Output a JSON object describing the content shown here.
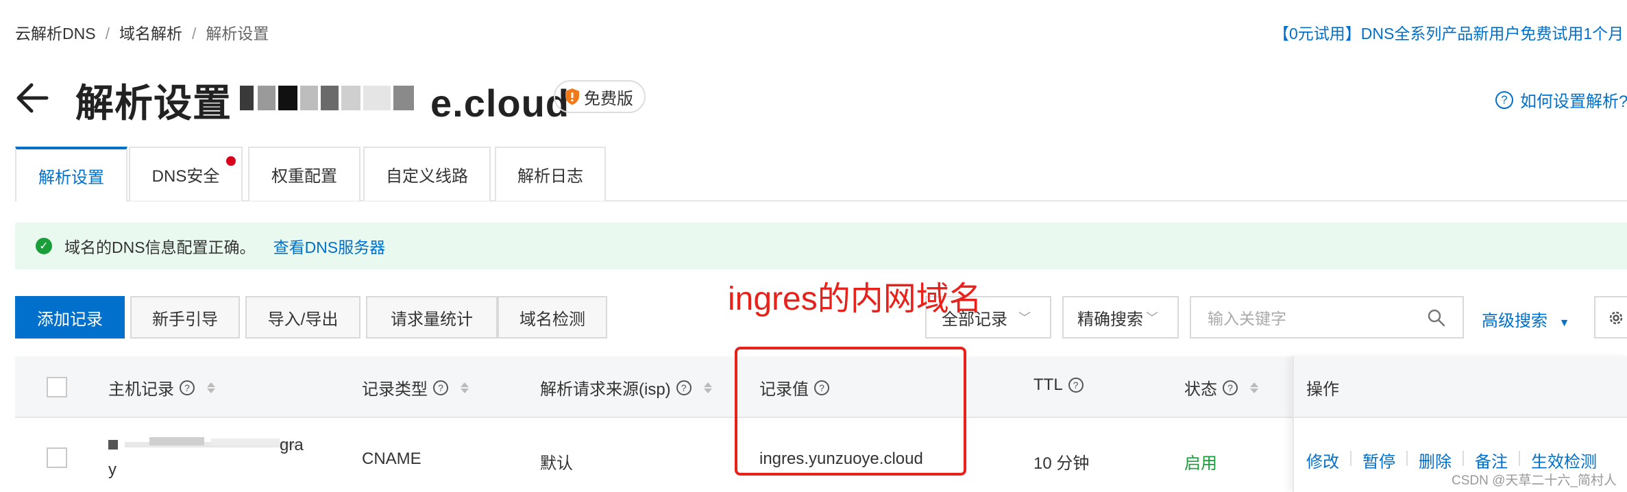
{
  "breadcrumb": {
    "item1": "云解析DNS",
    "item2": "域名解析",
    "item3": "解析设置",
    "separator": "/"
  },
  "promo": "【0元试用】DNS全系列产品新用户免费试用1个月",
  "header": {
    "title_prefix": "解析设置",
    "title_suffix": "e.cloud",
    "badge": "免费版"
  },
  "help_link": "如何设置解析?",
  "tabs": [
    "解析设置",
    "DNS安全",
    "权重配置",
    "自定义线路",
    "解析日志"
  ],
  "alert": {
    "text": "域名的DNS信息配置正确。",
    "link": "查看DNS服务器"
  },
  "toolbar": {
    "add": "添加记录",
    "guide": "新手引导",
    "import_export": "导入/导出",
    "stats": "请求量统计",
    "check": "域名检测",
    "filter_select": "全部记录",
    "match_select": "精确搜索",
    "search_placeholder": "输入关键字",
    "advanced": "高级搜索"
  },
  "annotation": "ingres的内网域名",
  "table": {
    "columns": [
      "主机记录",
      "记录类型",
      "解析请求来源(isp)",
      "记录值",
      "TTL",
      "状态",
      "操作"
    ],
    "row": {
      "host_line1": "gra",
      "host_line2": "y",
      "type": "CNAME",
      "isp": "默认",
      "value": "ingres.yunzuoye.cloud",
      "ttl": "10 分钟",
      "status": "启用",
      "actions": [
        "修改",
        "暂停",
        "删除",
        "备注",
        "生效检测"
      ]
    }
  },
  "watermark": "CSDN @天草二十六_简村人",
  "colors": {
    "accent": "#0070cc",
    "success": "#1a9e3a",
    "annotation": "#e8211b"
  }
}
